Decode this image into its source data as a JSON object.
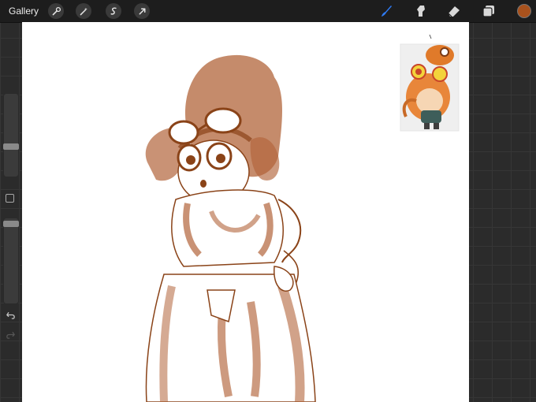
{
  "app": {
    "gallery_label": "Gallery"
  },
  "toolbar": {
    "left_tools": [
      {
        "name": "actions",
        "icon": "wrench-icon"
      },
      {
        "name": "adjustments",
        "icon": "magic-wand-icon"
      },
      {
        "name": "selection",
        "icon": "selection-s-icon"
      },
      {
        "name": "transform",
        "icon": "arrow-cursor-icon"
      }
    ],
    "right_tools": [
      {
        "name": "brush",
        "icon": "brush-icon",
        "active": true
      },
      {
        "name": "smudge",
        "icon": "smudge-icon",
        "active": false
      },
      {
        "name": "eraser",
        "icon": "eraser-icon",
        "active": false
      },
      {
        "name": "layers",
        "icon": "layers-icon",
        "active": false
      }
    ],
    "current_color": "#a9521d"
  },
  "sidebar": {
    "brush_size_level": 0.35,
    "opacity_level": 0.97
  },
  "colors": {
    "active_tool": "#2f7cf6",
    "sketch_stroke": "#8a4318",
    "sketch_fill": "#b2643a"
  }
}
